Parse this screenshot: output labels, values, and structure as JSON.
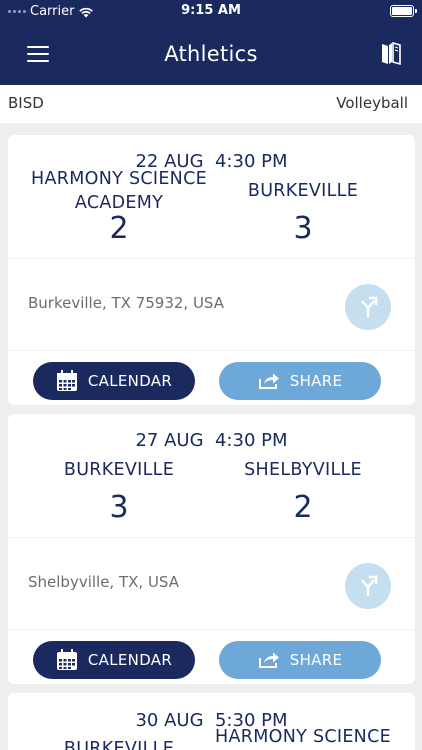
{
  "status_bar": {
    "carrier": "Carrier",
    "time": "9:15 AM"
  },
  "header": {
    "title": "Athletics",
    "menu_icon": "hamburger-menu-icon",
    "right_icon": "book-icon"
  },
  "filters": {
    "district": "BISD",
    "sport": "Volleyball"
  },
  "colors": {
    "navy": "#1a2a5e",
    "share_blue": "#6ea8d9",
    "direction_circle": "#c5def0"
  },
  "buttons": {
    "calendar": "CALENDAR",
    "share": "SHARE"
  },
  "games": [
    {
      "date": "22 AUG  4:30 PM",
      "home_team": "HARMONY SCIENCE ACADEMY",
      "away_team": "BURKEVILLE",
      "home_score": "2",
      "away_score": "3",
      "location": "Burkeville, TX 75932, USA"
    },
    {
      "date": "27 AUG  4:30 PM",
      "home_team": "BURKEVILLE",
      "away_team": "SHELBYVILLE",
      "home_score": "3",
      "away_score": "2",
      "location": "Shelbyville, TX, USA"
    },
    {
      "date": "30 AUG  5:30 PM",
      "home_team": "BURKEVILLE",
      "away_team": "HARMONY SCIENCE ACADEMY"
    }
  ]
}
